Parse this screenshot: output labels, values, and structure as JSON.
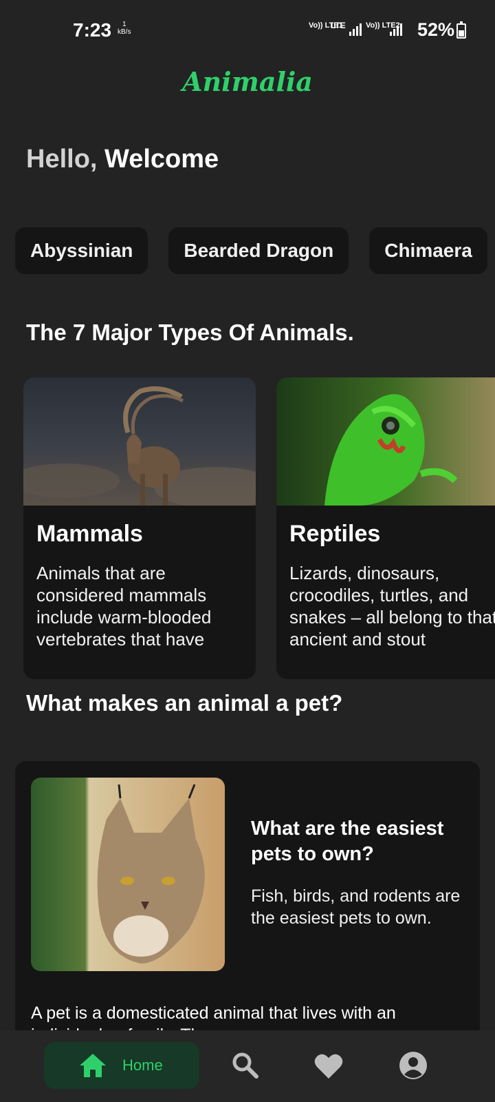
{
  "status": {
    "time": "7:23",
    "net_speed_value": "1",
    "net_speed_unit": "kB/s",
    "sim1": "Vo)) LTE1",
    "lte": "LTE",
    "sim2": "Vo)) LTE2",
    "battery": "52%"
  },
  "app": {
    "title": "Animalia"
  },
  "greeting": {
    "hello": "Hello,",
    "welcome": " Welcome"
  },
  "chips": [
    "Abyssinian",
    "Bearded Dragon",
    "Chimaera"
  ],
  "types_section": {
    "title": "The 7 Major Types Of Animals.",
    "cards": [
      {
        "title": "Mammals",
        "desc": "Animals that are considered mammals include warm-blooded vertebrates that have"
      },
      {
        "title": "Reptiles",
        "desc": "Lizards, dinosaurs, crocodiles, turtles, and snakes – all belong to that ancient and stout"
      }
    ]
  },
  "pet_section": {
    "title": "What makes an animal a pet?",
    "question": "What are the easiest pets to own?",
    "answer": "Fish, birds, and rodents are the easiest pets to own.",
    "body": "A pet is a domesticated animal that lives with an individual or family. They are ..."
  },
  "nav": {
    "home_label": "Home",
    "accent": "#2fd06b"
  }
}
